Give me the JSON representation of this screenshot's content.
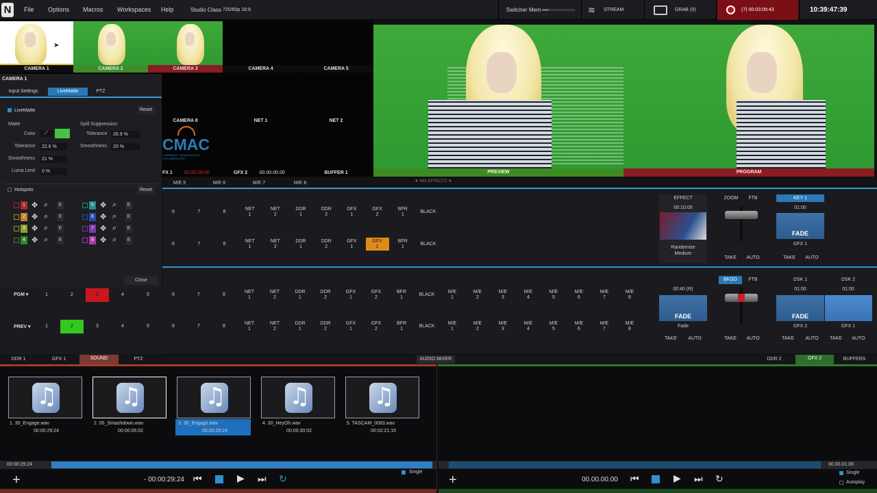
{
  "menu": {
    "logo": "N",
    "items": [
      "File",
      "Options",
      "Macros",
      "Workspaces",
      "Help"
    ],
    "session": "Studio Class",
    "format": "720/60p 16:9"
  },
  "status": {
    "switcher_mem": "Switcher Mem",
    "stream": "STREAM",
    "grab": "GRAB",
    "grab_count": "(0)",
    "record": "(7) 00:03:09:43",
    "clock": "10:39:47:39",
    "rec_color": "#b3161c"
  },
  "inputs": {
    "row1": [
      "CAMERA 1",
      "CAMERA 2",
      "CAMERA 3",
      "CAMERA 4",
      "CAMERA 5"
    ],
    "row2": [
      "CAMERA 8",
      "NET 1",
      "NET 2"
    ],
    "row3": [
      "FX 1",
      "GFX 2",
      "BUFFER 1"
    ],
    "row3_times": [
      "00:00:05:00",
      "00.00.00.00"
    ],
    "cam_label_colors": {
      "camera2": "#3f8c2a",
      "camera3": "#8b1b24"
    }
  },
  "cmac": {
    "title": "CMAC",
    "sub": "COMMUNITY MEDIA ACCESS COLLABORATIVE"
  },
  "preview_label": "PREVIEW",
  "program_label": "PROGRAM",
  "preview_color": "#3e8a22",
  "program_color": "#8c1b22",
  "camera_panel": {
    "title": "CAMERA 1",
    "tabs": [
      "Input Settings",
      "LiveMatte",
      "PTZ"
    ],
    "livematte_label": "LiveMatte",
    "reset": "Reset",
    "matte_title": "Matte",
    "spill_title": "Spill Suppression",
    "color_label": "Color",
    "matte_color": "#47c146",
    "tolerance_label": "Tolerance",
    "tolerance_value": "22.6 %",
    "smoothness_label": "Smoothness",
    "smoothness_value": "21 %",
    "luma_label": "Luma Limit",
    "luma_value": "0 %",
    "spill_tol_label": "Tolerance",
    "spill_tol_value": "26.9 %",
    "spill_smooth_label": "Smoothness",
    "spill_smooth_value": "20 %",
    "hotspots_label": "Hotspots",
    "hotspots_reset": "Reset",
    "hotspot_nums_left": [
      "1",
      "2",
      "3",
      "4"
    ],
    "hotspot_nums_right": [
      "5",
      "6",
      "7",
      "8"
    ],
    "hotspot_e": "E",
    "close": "Close"
  },
  "me_tabs": [
    "M/E 5",
    "M/E 6",
    "M/E 7",
    "M/E 8"
  ],
  "mix_effects": "MIX EFFECTS",
  "me_row": [
    {
      "t": "6"
    },
    {
      "t": "7"
    },
    {
      "t": "8"
    },
    {
      "t": "NET",
      "s": "1"
    },
    {
      "t": "NET",
      "s": "2"
    },
    {
      "t": "DDR",
      "s": "1"
    },
    {
      "t": "DDR",
      "s": "2"
    },
    {
      "t": "GFX",
      "s": "1"
    },
    {
      "t": "GFX",
      "s": "2"
    },
    {
      "t": "BFR",
      "s": "1"
    },
    {
      "t": "BLACK"
    }
  ],
  "me_effect": {
    "effect": "EFFECT",
    "time": "00:10:00",
    "random": "Randomize",
    "medium": "Medium",
    "zoom": "ZOOM",
    "ftb": "FTB",
    "key1": "KEY 1",
    "key_time": "01:00",
    "fade": "FADE",
    "gfx1": "GFX 1",
    "take": "TAKE",
    "auto": "AUTO"
  },
  "pgm_label": "PGM",
  "prev_label": "PREV",
  "main_row": [
    {
      "t": "1"
    },
    {
      "t": "2"
    },
    {
      "t": "3"
    },
    {
      "t": "4"
    },
    {
      "t": "5"
    },
    {
      "t": "6"
    },
    {
      "t": "7"
    },
    {
      "t": "8"
    },
    {
      "t": "NET",
      "s": "1"
    },
    {
      "t": "NET",
      "s": "2"
    },
    {
      "t": "DDR",
      "s": "1"
    },
    {
      "t": "DDR",
      "s": "2"
    },
    {
      "t": "GFX",
      "s": "1"
    },
    {
      "t": "GFX",
      "s": "2"
    },
    {
      "t": "BFR",
      "s": "1"
    },
    {
      "t": "BLACK"
    },
    {
      "t": "M/E",
      "s": "1"
    },
    {
      "t": "M/E",
      "s": "2"
    },
    {
      "t": "M/E",
      "s": "3"
    },
    {
      "t": "M/E",
      "s": "4"
    },
    {
      "t": "M/E",
      "s": "5"
    },
    {
      "t": "M/E",
      "s": "6"
    },
    {
      "t": "M/E",
      "s": "7"
    },
    {
      "t": "M/E",
      "s": "8"
    }
  ],
  "main_trans": {
    "time": "00:40 (R)",
    "fade": "FADE",
    "fade_sub": "Fade",
    "bkgd": "BKGD",
    "ftb": "FTB",
    "dsk1": "DSK 1",
    "dsk2": "DSK 2",
    "dsk_time": "01:00",
    "dsk1_src": "GFX 2",
    "dsk2_src": "GFX 1",
    "take": "TAKE",
    "auto": "AUTO"
  },
  "bottom_tabs_left": [
    "DDR 1",
    "GFX 1",
    "SOUND",
    "PTZ"
  ],
  "audio_mixer": "AUDIO MIXER",
  "bottom_tabs_right": [
    "DDR 2",
    "GFX 2",
    "BUFFERS"
  ],
  "media": [
    {
      "name": "1. 30_Engage.wav",
      "dur": "00:00:29:24"
    },
    {
      "name": "2. 05_Smashdown.wav",
      "dur": "00:00:05:02"
    },
    {
      "name": "3. 30_Engage.wav",
      "dur": "00:00:29:24"
    },
    {
      "name": "4. 30_HeyOh.wav",
      "dur": "00:00:30:02"
    },
    {
      "name": "5. TASCAM_0083.wav",
      "dur": "00:02:21:15"
    }
  ],
  "left_player": {
    "pos": "00:00:29:24",
    "remain": "- 00:00:29:24",
    "single": "Single"
  },
  "right_player": {
    "time": "00.00.00.00",
    "pos": "00.00.01.00",
    "single": "Single",
    "autoplay": "Autoplay"
  }
}
